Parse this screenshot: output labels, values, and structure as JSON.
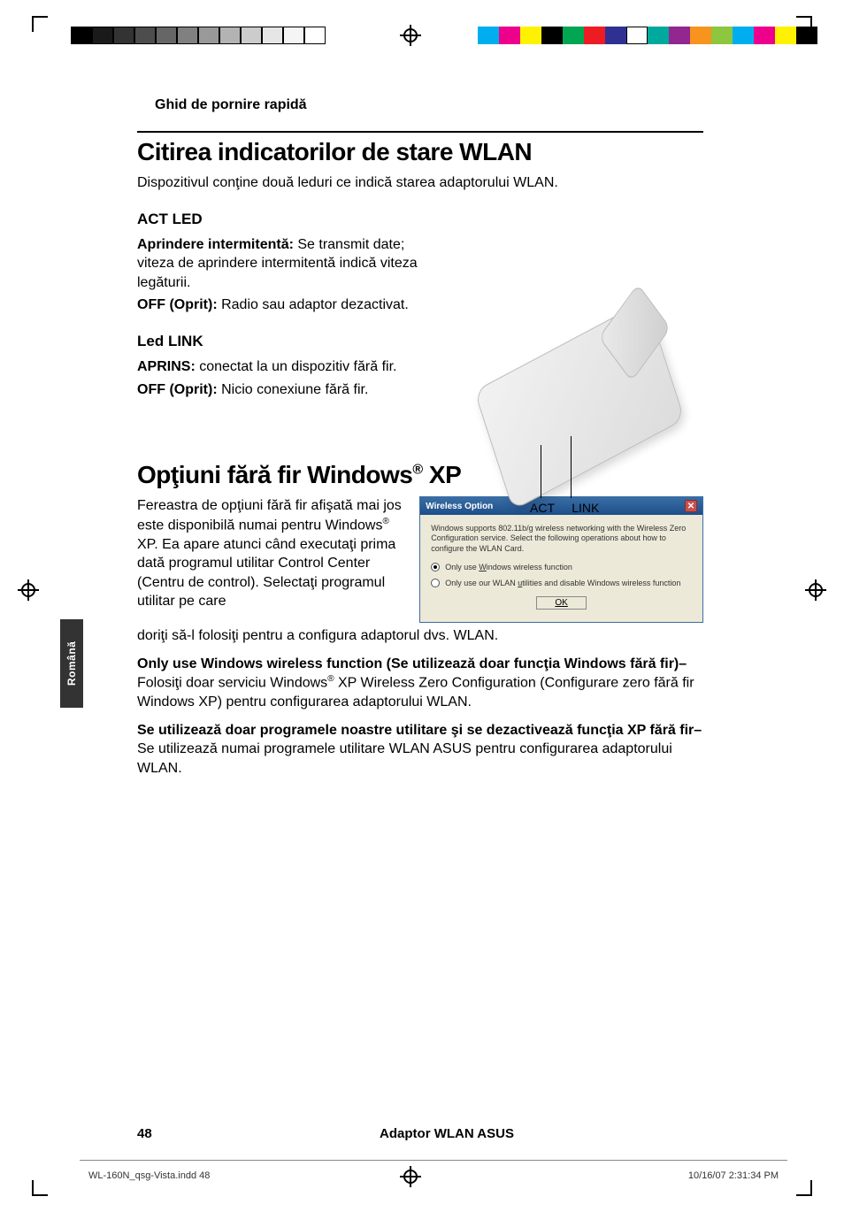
{
  "header": {
    "running_head": "Ghid de pornire rapidă"
  },
  "section1": {
    "title": "Citirea indicatorilor de stare WLAN",
    "intro": "Dispozitivul conţine două leduri ce indică starea adaptorului WLAN.",
    "act": {
      "heading": "ACT LED",
      "l1b": "Aprindere intermitentă: ",
      "l1": "Se transmit date; viteza de aprindere intermitentă indică viteza legăturii.",
      "l2b": "OFF (Oprit): ",
      "l2": "Radio sau adaptor dezactivat."
    },
    "link": {
      "heading": "Led LINK",
      "l1b": "APRINS: ",
      "l1": "conectat la un dispozitiv fără fir.",
      "l2b": "OFF (Oprit): ",
      "l2": "Nicio conexiune fără fir."
    },
    "labels": {
      "act": "ACT",
      "link": "LINK"
    }
  },
  "section2": {
    "title_pre": "Opţiuni fără fir Windows",
    "title_post": " XP",
    "para1": "Fereastra de opţiuni fără fir afişată mai jos este disponibilă numai pentru Windows",
    "para1b": " XP. Ea apare atunci când executaţi prima dată programul utilitar Control Center (Centru de control). Selectaţi programul utilitar pe care",
    "para1c": "doriţi să-l folosiţi pentru a configura adaptorul dvs. WLAN.",
    "opt1b": "Only use Windows wireless function (Se utilizează doar funcţia Windows fără fir)– ",
    "opt1": "Folosiţi doar serviciu Windows",
    "opt1c": " XP Wireless Zero Configuration (Configurare zero fără fir Windows XP) pentru configurarea adaptorului WLAN.",
    "opt2b": "Se utilizează doar programele noastre utilitare şi se dezactivează funcţia XP fără fir– ",
    "opt2": "Se utilizează numai programele utilitare WLAN ASUS pentru configurarea adaptorului WLAN."
  },
  "dialog": {
    "title": "Wireless Option",
    "desc": "Windows supports 802.11b/g wireless networking with the Wireless Zero Configuration service. Select the following operations about how to configure the WLAN Card.",
    "radio1_u": "W",
    "radio1": "Only use ",
    "radio1b": "indows wireless function",
    "radio2_u": "u",
    "radio2": "Only use our WLAN ",
    "radio2b": "tilities and disable Windows wireless function",
    "ok": "OK"
  },
  "sidebar": {
    "lang": "Română"
  },
  "footer": {
    "page": "48",
    "title": "Adaptor WLAN ASUS",
    "slug_file": "WL-160N_qsg-Vista.indd   48",
    "slug_time": "10/16/07   2:31:34 PM"
  }
}
